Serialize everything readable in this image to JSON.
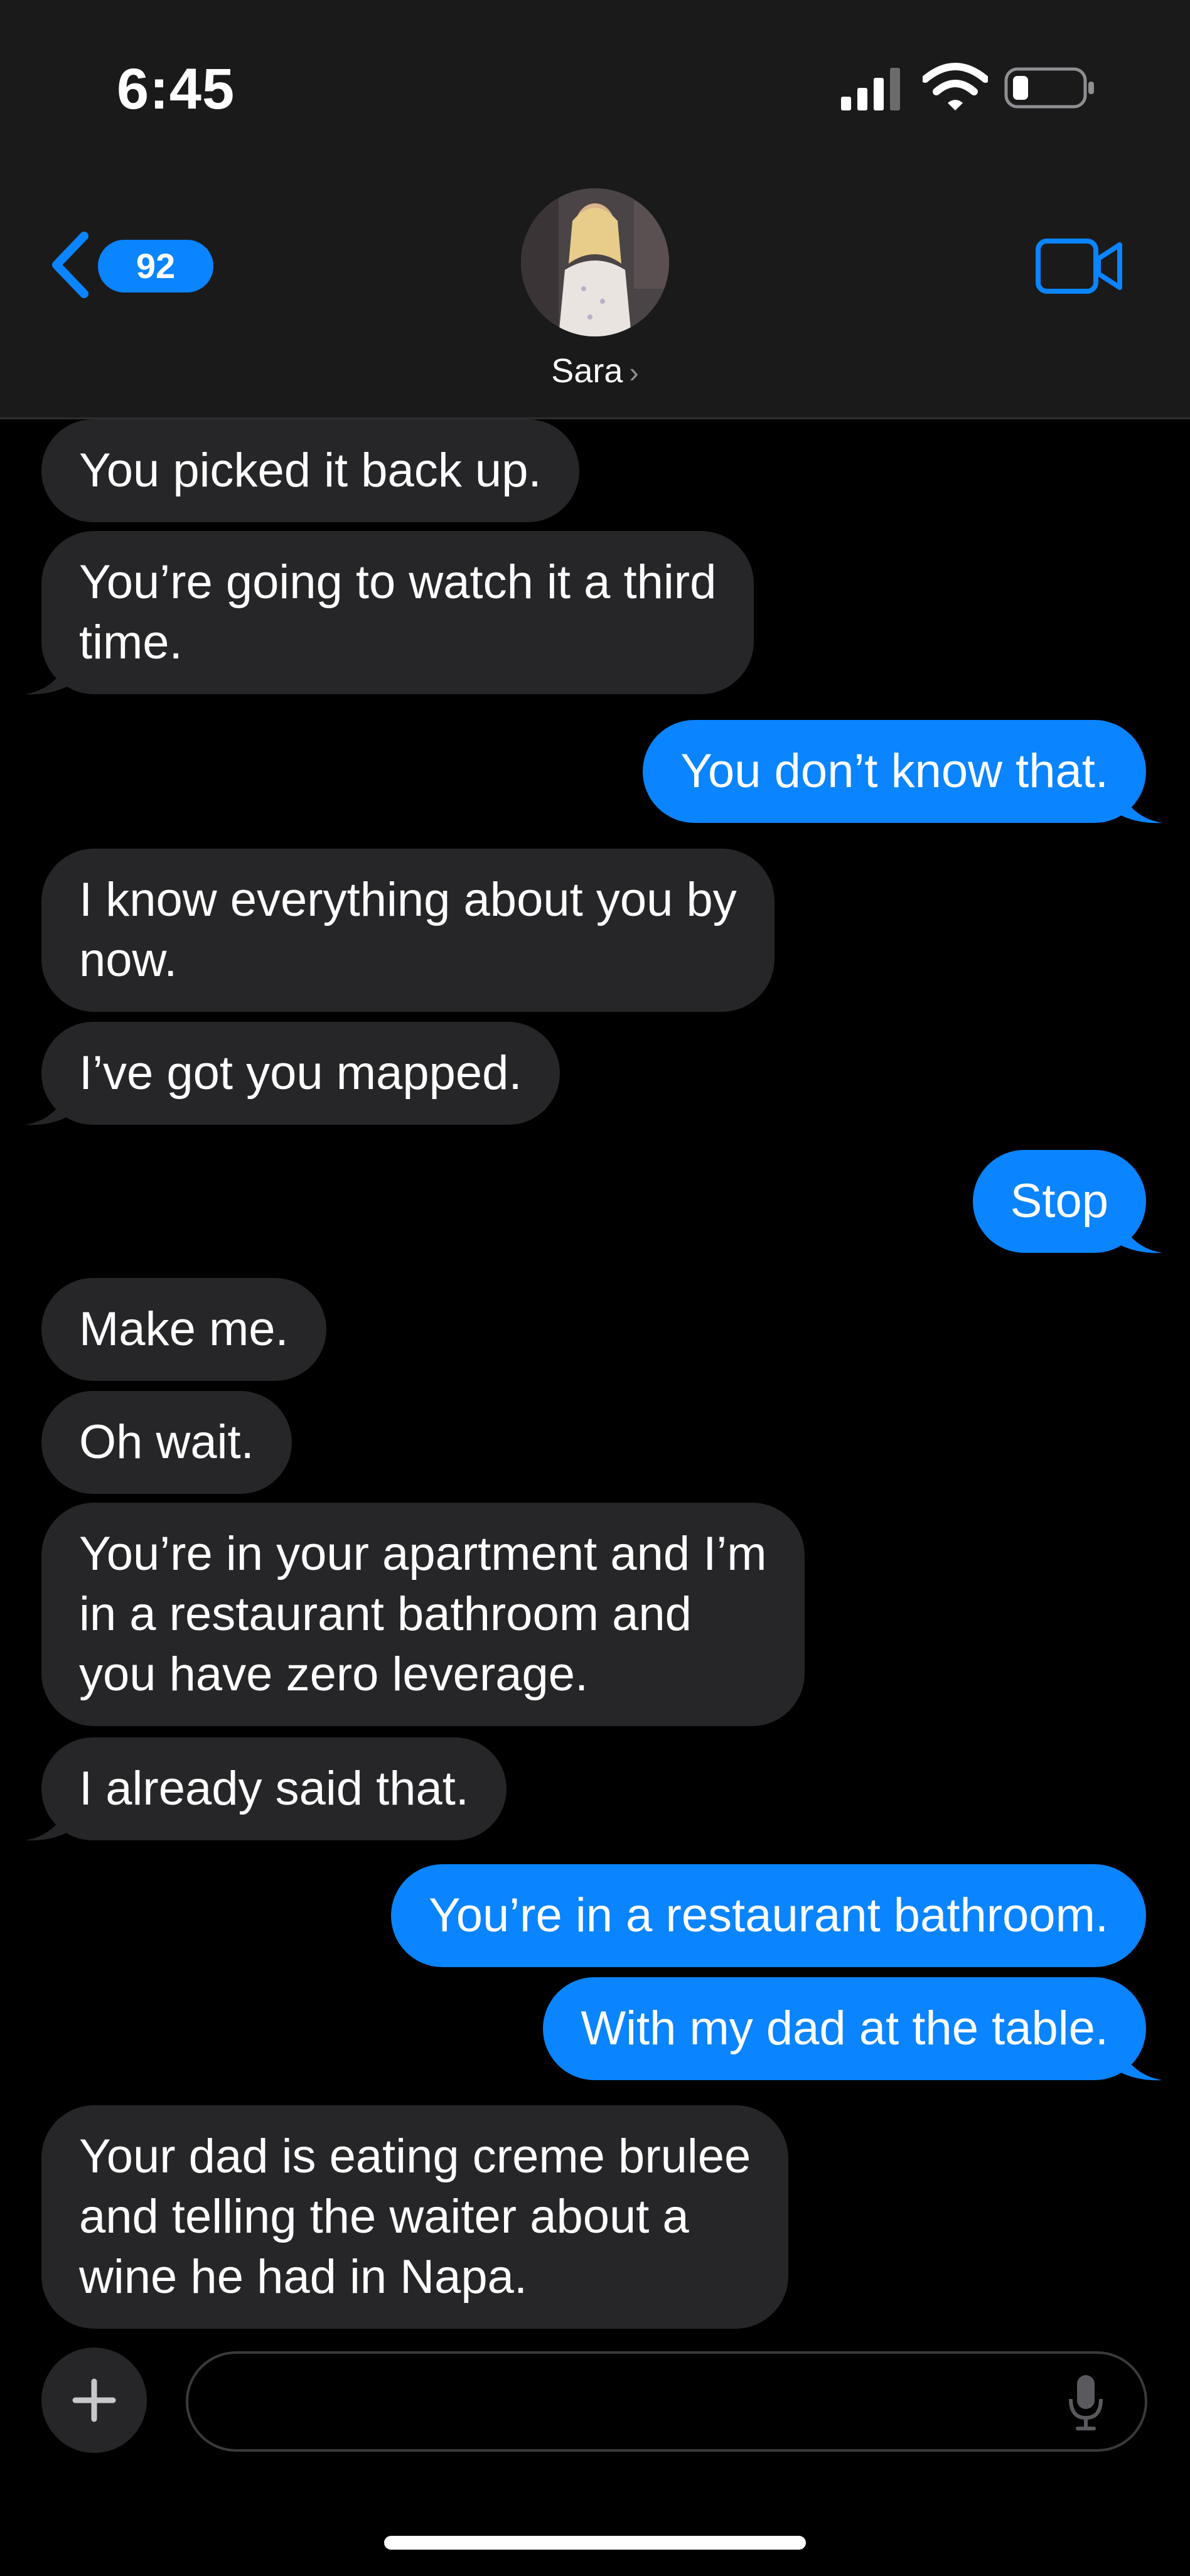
{
  "status_bar": {
    "time": "6:45",
    "icons": [
      "cellular-signal-icon",
      "wifi-icon",
      "battery-icon"
    ]
  },
  "header": {
    "back_badge": "92",
    "contact_name": "Sara",
    "icons": [
      "back-chevron-icon",
      "video-call-icon",
      "chevron-right-icon"
    ]
  },
  "messages": [
    {
      "from": "them",
      "text": "You picked it back up."
    },
    {
      "from": "them",
      "lines": [
        "You’re going to watch it a third",
        "time."
      ]
    },
    {
      "from": "me",
      "text": "You don’t know that."
    },
    {
      "from": "them",
      "lines": [
        "I know everything about you by",
        "now."
      ]
    },
    {
      "from": "them",
      "text": "I’ve got you mapped."
    },
    {
      "from": "me",
      "text": "Stop"
    },
    {
      "from": "them",
      "text": "Make me."
    },
    {
      "from": "them",
      "text": "Oh wait."
    },
    {
      "from": "them",
      "lines": [
        "You’re in your apartment and I’m",
        "in a restaurant bathroom and",
        "you have zero leverage."
      ]
    },
    {
      "from": "them",
      "text": "I already said that."
    },
    {
      "from": "me",
      "text": "You’re in a restaurant bathroom."
    },
    {
      "from": "me",
      "text": "With my dad at the table."
    },
    {
      "from": "them",
      "lines": [
        "Your dad is eating creme brulee",
        "and telling the waiter about a",
        "wine he had in Napa."
      ]
    }
  ],
  "composer": {
    "placeholder": "",
    "icons": [
      "plus-icon",
      "microphone-icon"
    ]
  },
  "colors": {
    "outgoing_bubble": "#0a84ff",
    "incoming_bubble": "#262628",
    "background": "#000000",
    "header_bg": "#1a1a1a"
  }
}
